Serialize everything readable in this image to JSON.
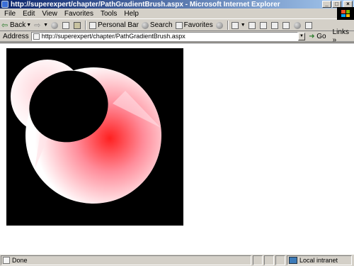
{
  "window": {
    "title": "http://superexpert/chapter/PathGradientBrush.aspx - Microsoft Internet Explorer",
    "minimize": "_",
    "maximize": "□",
    "close": "×"
  },
  "menu": [
    "File",
    "Edit",
    "View",
    "Favorites",
    "Tools",
    "Help"
  ],
  "toolbar": {
    "back": "Back",
    "personal_bar": "Personal Bar",
    "search": "Search",
    "favorites": "Favorites"
  },
  "address": {
    "label": "Address",
    "url": "http://superexpert/chapter/PathGradientBrush.aspx",
    "go": "Go",
    "links": "Links »"
  },
  "status": {
    "text": "Done",
    "zone": "Local intranet"
  },
  "colors": {
    "canvas_bg": "#000000",
    "gradient_center": "#ff0000",
    "gradient_edge": "#ffffff"
  }
}
